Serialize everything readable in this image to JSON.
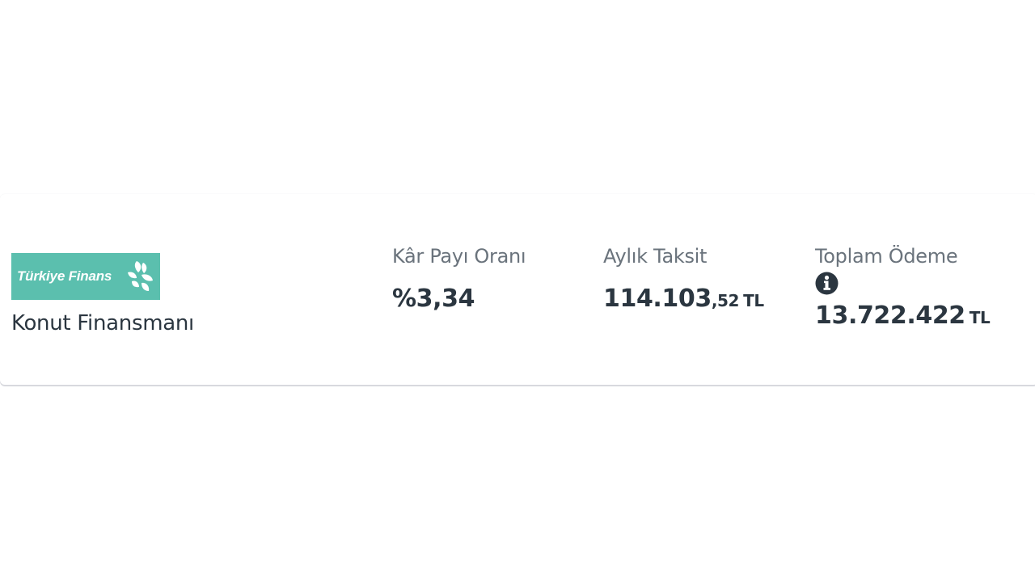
{
  "provider": {
    "logo_text": "Türkiye Finans",
    "product_name": "Konut Finansmanı",
    "brand_color": "#5bbfae"
  },
  "metrics": [
    {
      "label": "Kâr Payı Oranı",
      "value": "%3,34"
    },
    {
      "label": "Aylık Taksit",
      "value_main": "114.103",
      "value_frac": ",52",
      "unit": "TL"
    },
    {
      "label": "Toplam Ödeme",
      "info_icon": "info-icon",
      "value_main": "13.722.422",
      "unit": "TL"
    }
  ],
  "colors": {
    "text_primary": "#2b3640",
    "text_label": "#6a737c",
    "card_shadow": "#d8d9de"
  }
}
